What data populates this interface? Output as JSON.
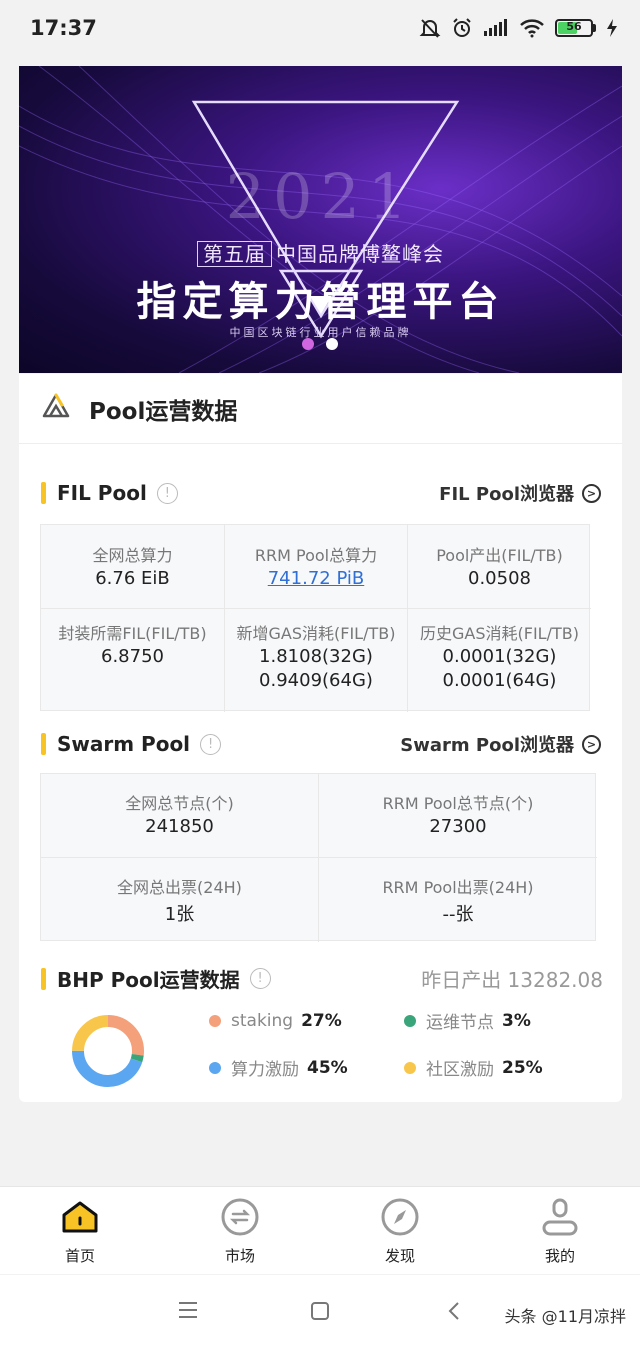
{
  "status_bar": {
    "time": "17:37",
    "battery": "56"
  },
  "banner": {
    "year": "2021",
    "edition_tag": "第五届",
    "subtitle": "中国品牌博鳌峰会",
    "title": "指定算力管理平台",
    "tagline": "中国区块链行业用户信赖品牌",
    "slides": 2,
    "active_slide": 0
  },
  "card": {
    "title": "Pool运营数据"
  },
  "fil_pool": {
    "title": "FIL Pool",
    "browser_link": "FIL Pool浏览器",
    "cells": [
      {
        "label": "全网总算力",
        "values": [
          "6.76 EiB"
        ]
      },
      {
        "label": "RRM Pool总算力",
        "values": [
          "741.72 PiB"
        ]
      },
      {
        "label": "Pool产出(FIL/TB)",
        "values": [
          "0.0508"
        ]
      },
      {
        "label": "封装所需FIL(FIL/TB)",
        "values": [
          "6.8750"
        ]
      },
      {
        "label": "新增GAS消耗(FIL/TB)",
        "values": [
          "1.8108(32G)",
          "0.9409(64G)"
        ]
      },
      {
        "label": "历史GAS消耗(FIL/TB)",
        "values": [
          "0.0001(32G)",
          "0.0001(64G)"
        ]
      }
    ]
  },
  "swarm_pool": {
    "title": "Swarm Pool",
    "browser_link": "Swarm Pool浏览器",
    "cells": [
      {
        "label": "全网总节点(个)",
        "value": "241850"
      },
      {
        "label": "RRM Pool总节点(个)",
        "value": "27300"
      },
      {
        "label": "全网总出票(24H)",
        "value": "1张"
      },
      {
        "label": "RRM Pool出票(24H)",
        "value": "--张"
      }
    ]
  },
  "bhp_pool": {
    "title": "BHP Pool运营数据",
    "yesterday_output": "昨日产出 13282.08",
    "distribution": [
      {
        "name": "staking",
        "percent": "27%",
        "value": 27,
        "color": "#f4a07a"
      },
      {
        "name": "运维节点",
        "percent": "3%",
        "value": 3,
        "color": "#3aa57a"
      },
      {
        "name": "算力激励",
        "percent": "45%",
        "value": 45,
        "color": "#5aa6f0"
      },
      {
        "name": "社区激励",
        "percent": "25%",
        "value": 25,
        "color": "#f8c64a"
      }
    ]
  },
  "bottom_nav": [
    {
      "label": "首页",
      "icon": "home-icon",
      "active": true
    },
    {
      "label": "市场",
      "icon": "market-exchange-icon",
      "active": false
    },
    {
      "label": "发现",
      "icon": "compass-icon",
      "active": false
    },
    {
      "label": "我的",
      "icon": "user-icon",
      "active": false
    }
  ],
  "watermark": "头条 @11月凉拌"
}
